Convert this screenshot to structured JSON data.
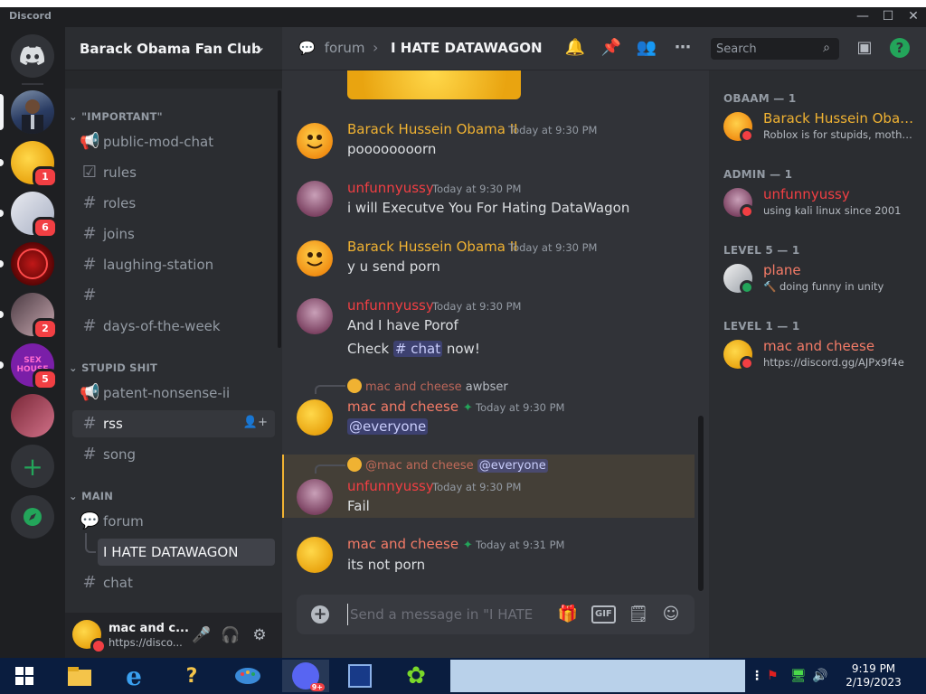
{
  "app": {
    "title": "Discord"
  },
  "window_controls": {
    "minimize": "—",
    "maximize": "☐",
    "close": "✕"
  },
  "rail": {
    "badges": [
      "1",
      "6",
      "2",
      "5"
    ],
    "server_labels": [
      "SEX HOUSE"
    ]
  },
  "guild": {
    "name": "Barack Obama Fan Club"
  },
  "categories": {
    "important": "\"IMPORTANT\"",
    "stupid": "STUPID SHIT",
    "main": "MAIN"
  },
  "channels": {
    "public_mod_chat": "public-mod-chat",
    "rules": "rules",
    "roles": "roles",
    "joins": "joins",
    "laughing_station": "laughing-station",
    "unnamed": "",
    "days_of_week": "days-of-the-week",
    "patent": "patent-nonsense-ii",
    "rss": "rss",
    "song": "song",
    "forum": "forum",
    "thread": "I HATE DATAWAGON",
    "chat": "chat"
  },
  "user_panel": {
    "name": "mac and c...",
    "status": "https://disco..."
  },
  "header": {
    "breadcrumb_parent": "forum",
    "separator": "›",
    "title": "I HATE DATAWAGON",
    "search_placeholder": "Search"
  },
  "messages": [
    {
      "author": "Barack Hussein Obama II",
      "time": "Today at 9:30 PM",
      "text": "poooooooorn",
      "color": "#f0b232"
    },
    {
      "author": "unfunnyussy",
      "time": "Today at 9:30 PM",
      "text": "i will Executve You For Hating DataWagon",
      "color": "#f23f43"
    },
    {
      "author": "Barack Hussein Obama II",
      "time": "Today at 9:30 PM",
      "text": "y u send porn",
      "color": "#f0b232"
    },
    {
      "author": "unfunnyussy",
      "time": "Today at 9:30 PM",
      "text": "And I have Porof",
      "text2_pre": "Check ",
      "text2_mention": "# chat",
      "text2_post": " now!",
      "color": "#f23f43"
    },
    {
      "reply_author": "mac and cheese",
      "reply_text": "awbser",
      "author": "mac and cheese",
      "time": "Today at 9:30 PM",
      "text": "@everyone",
      "color": "#f47b67"
    },
    {
      "reply_author": "@mac and cheese",
      "reply_text": "@everyone",
      "author": "unfunnyussy",
      "time": "Today at 9:30 PM",
      "text": "Fail",
      "color": "#f23f43"
    },
    {
      "author": "mac and cheese",
      "time": "Today at 9:31 PM",
      "text": "its not porn",
      "color": "#f47b67"
    }
  ],
  "composer": {
    "placeholder": "Send a message in \"I HATE D...",
    "gif": "GIF"
  },
  "members": {
    "groups": [
      {
        "title": "OBAAM — 1",
        "name": "Barack Hussein Obam...",
        "status": "Roblox is for stupids, motherf...",
        "color": "#f0b232"
      },
      {
        "title": "ADMIN — 1",
        "name": "unfunnyussy",
        "status": "using kali linux since 2001",
        "color": "#f23f43"
      },
      {
        "title": "LEVEL 5 — 1",
        "name": "plane",
        "status": "🔨 doing funny in unity",
        "color": "#f47b67"
      },
      {
        "title": "LEVEL 1 — 1",
        "name": "mac and cheese",
        "status": "https://discord.gg/AJPx9f4e",
        "color": "#f47b67"
      }
    ]
  },
  "taskbar": {
    "time": "9:19 PM",
    "date": "2/19/2023",
    "discord_badge": "9+"
  }
}
